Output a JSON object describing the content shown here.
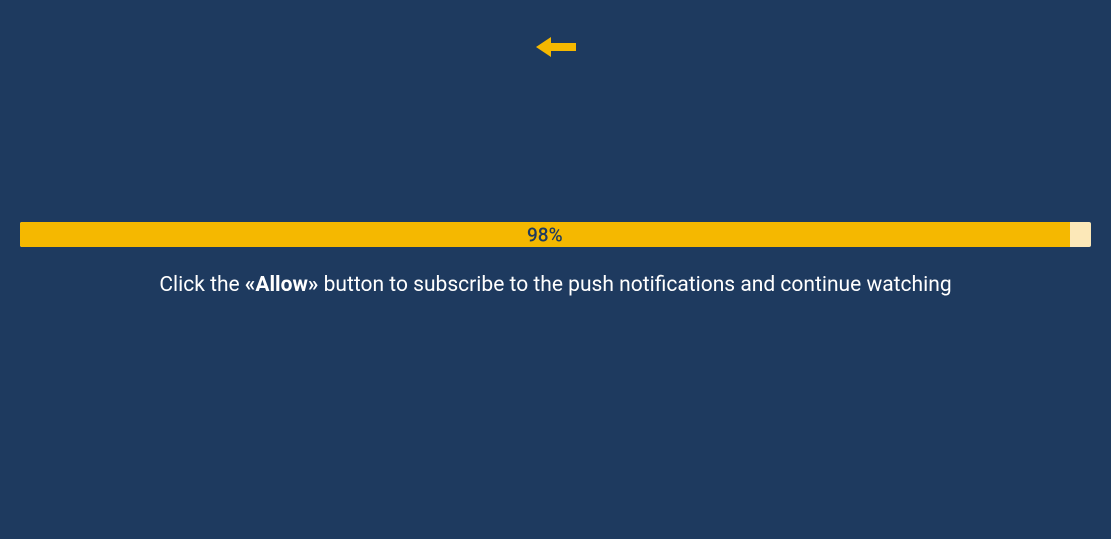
{
  "arrow": {
    "color": "#f5b800"
  },
  "progress": {
    "percent": 98,
    "label": "98%",
    "fill_color": "#f5b800",
    "track_color": "#fce8b8"
  },
  "instruction": {
    "prefix": "Click the ",
    "bold": "«Allow»",
    "suffix": " button to subscribe to the push notifications and continue watching"
  },
  "colors": {
    "background": "#1e3a5f",
    "accent": "#f5b800",
    "text": "#ffffff"
  }
}
